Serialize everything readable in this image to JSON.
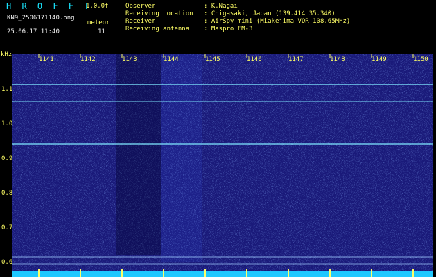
{
  "header": {
    "logo": "H R O F F T",
    "version": "1.0.0f",
    "filename": "KN9_2506171140.png",
    "meteor_label": "meteor",
    "datetime": "25.06.17 11:40",
    "meteor_count": "11",
    "info": [
      {
        "label": "Observer",
        "value": ": K.Nagai"
      },
      {
        "label": "Receiving Location",
        "value": ": Chigasaki, Japan (139.414 35.340)"
      },
      {
        "label": "Receiver",
        "value": ": AirSpy mini (Miakejima VOR 108.65MHz)"
      },
      {
        "label": "Receiving antenna",
        "value": ": Maspro FM-3"
      }
    ]
  },
  "y_axis": {
    "unit": "kHz",
    "ticks": [
      "1.1",
      "1.0",
      "0.9",
      "0.8",
      "0.7",
      "0.6"
    ]
  },
  "x_axis": {
    "ticks": [
      "1141",
      "1142",
      "1143",
      "1144",
      "1145",
      "1146",
      "1147",
      "1148",
      "1149",
      "1150"
    ]
  },
  "colors": {
    "background": "#000000",
    "spectrogram": "#1a1a7a",
    "noise_bright": "#6fa3ff",
    "signal_line": "#7fe8ff",
    "label": "#ffff66",
    "title": "#19e6ff"
  }
}
